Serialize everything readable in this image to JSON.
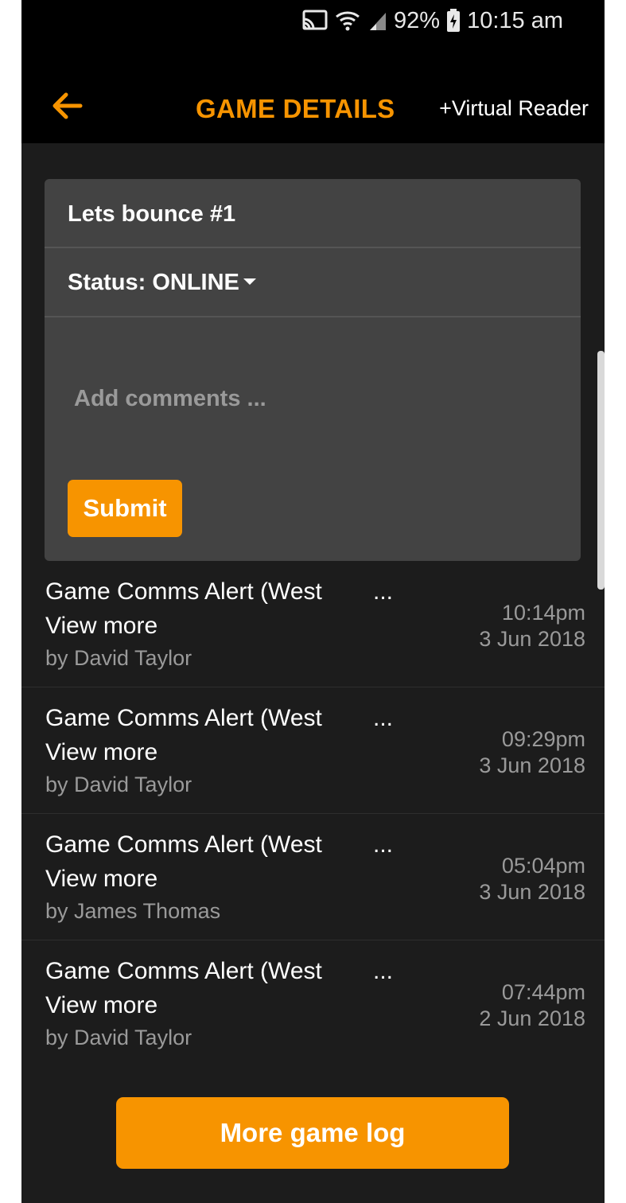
{
  "status_bar": {
    "battery": "92%",
    "time": "10:15 am"
  },
  "app_bar": {
    "title": "GAME DETAILS",
    "virtual_reader": "+Virtual Reader"
  },
  "card": {
    "game_name": "Lets bounce #1",
    "status_label": "Status: ONLINE",
    "comment_placeholder": "Add comments ...",
    "submit_label": "Submit"
  },
  "log": [
    {
      "title": "Game Comms Alert (West",
      "ellipsis": "...",
      "view_more": "View more",
      "author": "by David Taylor",
      "time": "10:14pm",
      "date": "3 Jun 2018"
    },
    {
      "title": "Game Comms Alert (West",
      "ellipsis": "...",
      "view_more": "View more",
      "author": "by David Taylor",
      "time": "09:29pm",
      "date": "3 Jun 2018"
    },
    {
      "title": "Game Comms Alert (West",
      "ellipsis": "...",
      "view_more": "View more",
      "author": "by James Thomas",
      "time": "05:04pm",
      "date": "3 Jun 2018"
    },
    {
      "title": "Game Comms Alert (West",
      "ellipsis": "...",
      "view_more": "View more",
      "author": "by David Taylor",
      "time": "07:44pm",
      "date": "2 Jun 2018"
    }
  ],
  "more_button": "More game log",
  "colors": {
    "accent": "#f79400",
    "background": "#1c1c1c",
    "card": "#434343"
  },
  "icons": [
    "cast-icon",
    "wifi-icon",
    "signal-icon",
    "battery-charging-icon",
    "back-arrow-icon",
    "dropdown-caret-icon"
  ]
}
